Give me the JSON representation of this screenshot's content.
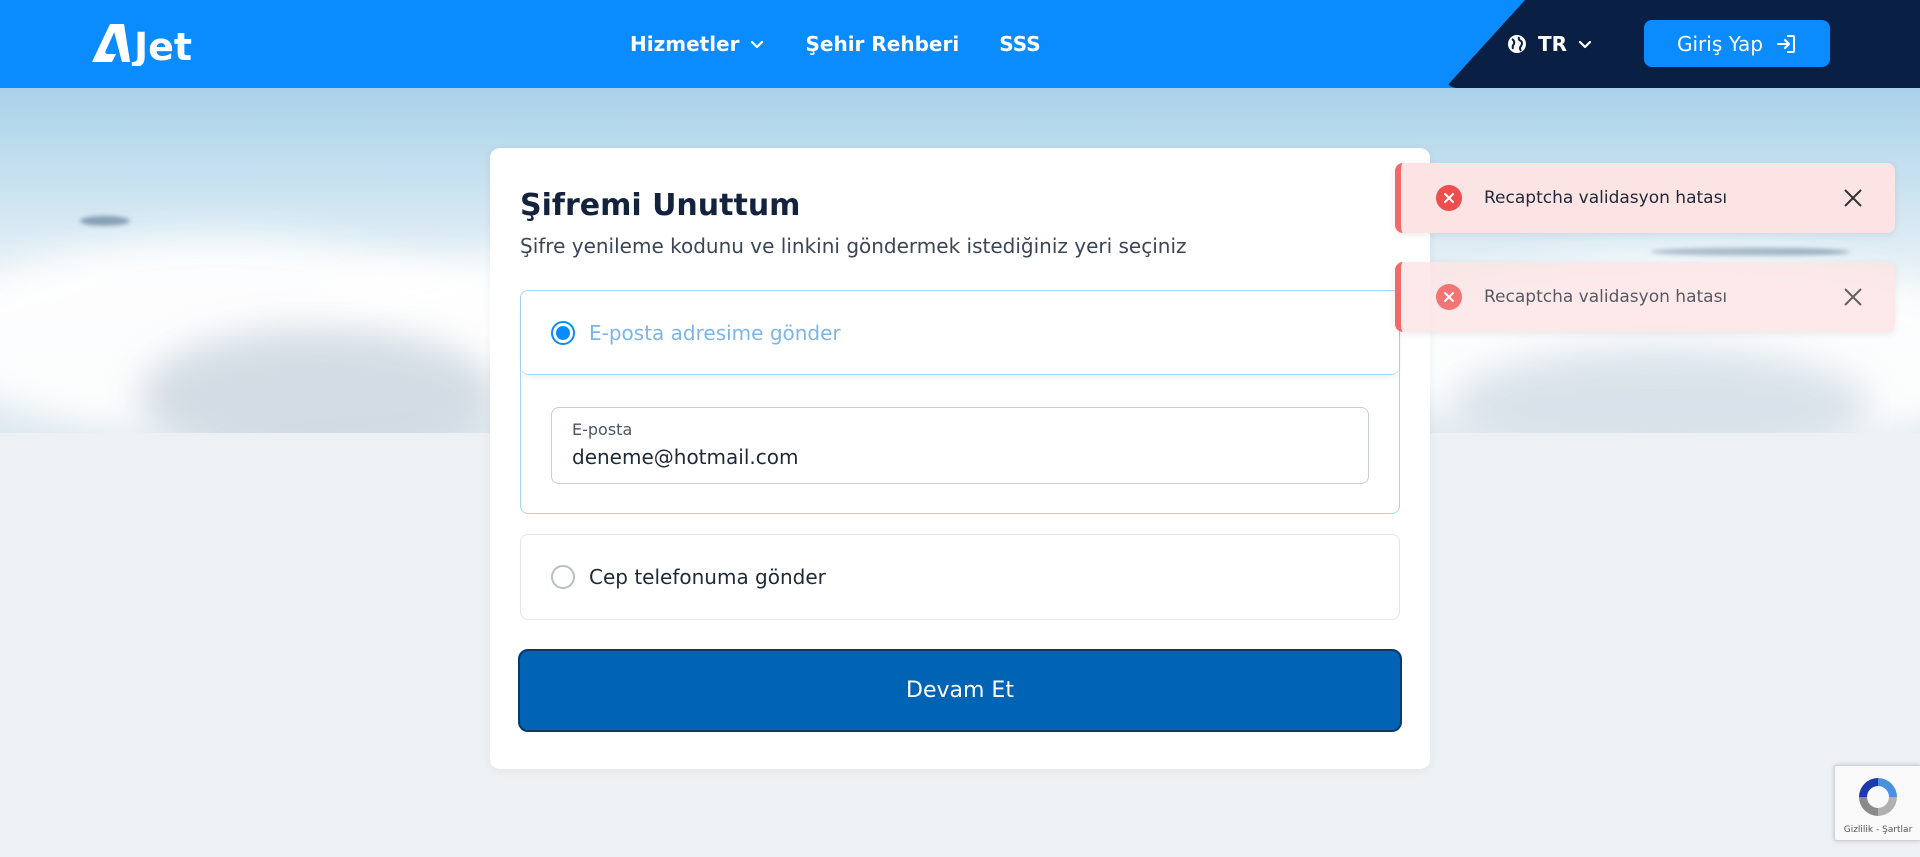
{
  "header": {
    "logo_text": "AJet",
    "nav": [
      {
        "label": "Hizmetler",
        "has_dropdown": true
      },
      {
        "label": "Şehir Rehberi",
        "has_dropdown": false
      },
      {
        "label": "SSS",
        "has_dropdown": false
      }
    ],
    "language": "TR",
    "login_label": "Giriş Yap"
  },
  "card": {
    "title": "Şifremi Unuttum",
    "subtitle": "Şifre yenileme kodunu ve linkini göndermek istediğiniz yeri seçiniz",
    "option_email_label": "E-posta adresime gönder",
    "option_email_selected": true,
    "email_field_label": "E-posta",
    "email_field_value": "deneme@hotmail.com",
    "option_phone_label": "Cep telefonuma gönder",
    "option_phone_selected": false,
    "continue_label": "Devam Et"
  },
  "toasts": [
    {
      "message": "Recaptcha validasyon hatası"
    },
    {
      "message": "Recaptcha validasyon hatası"
    }
  ],
  "recaptcha": {
    "links": "Gizlilik - Şartlar"
  },
  "colors": {
    "header_blue": "#0a8cff",
    "header_dark": "#0a1f44",
    "primary_button": "#0063b4",
    "error_red": "#ef4e4e",
    "toast_bg": "#fde4e4"
  },
  "icons": [
    "chevron-down-icon",
    "globe-icon",
    "login-arrow-icon",
    "error-icon",
    "close-icon",
    "recaptcha-icon"
  ]
}
